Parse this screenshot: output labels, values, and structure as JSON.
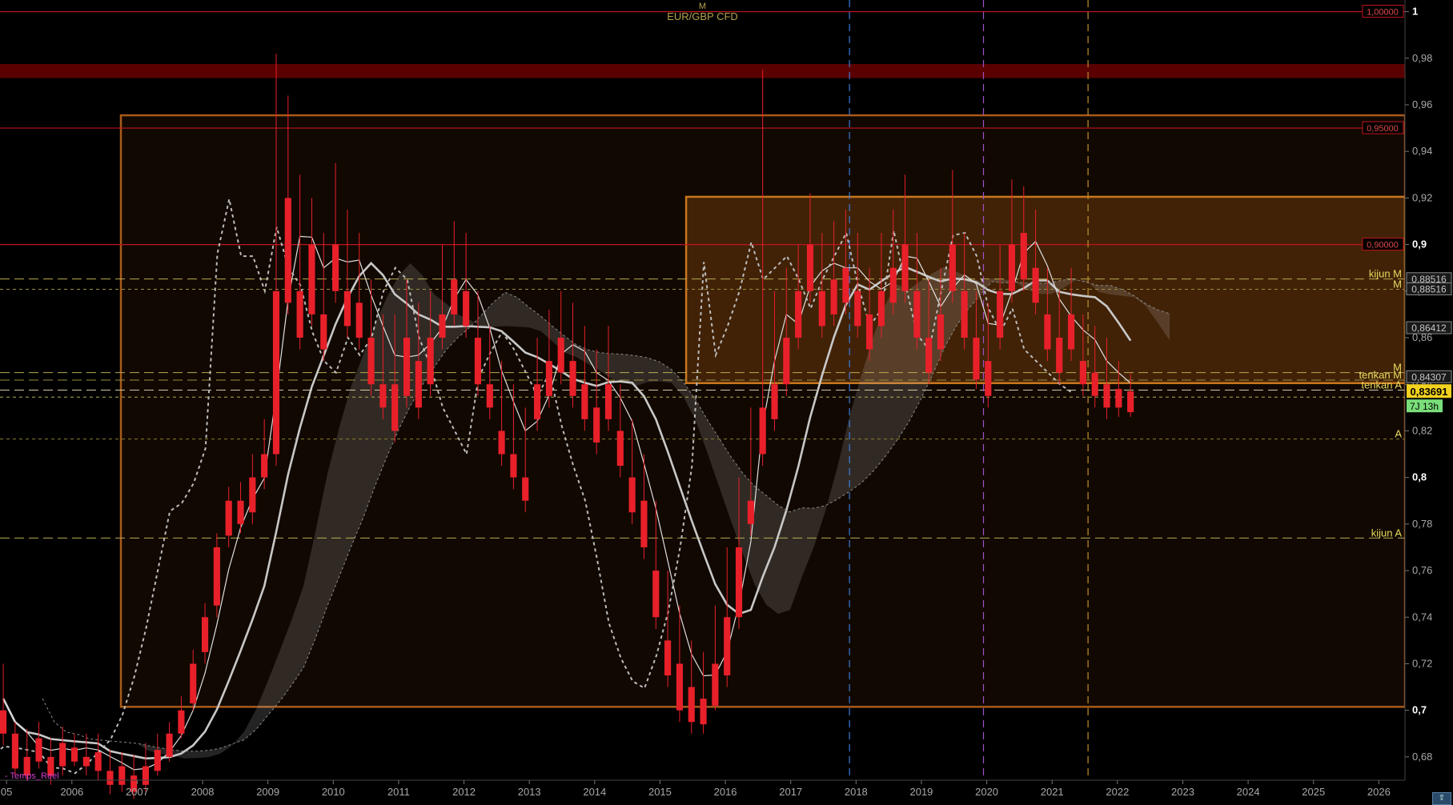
{
  "header": {
    "timeframe": "M",
    "symbol": "EUR/GBP CFD"
  },
  "status": {
    "mode": "- Temps_Reel"
  },
  "scroll_icon": "scroll-up-arrow-icon",
  "chart_data": {
    "type": "candlestick",
    "symbol": "EUR/GBP CFD",
    "timeframe": "M",
    "x_ticks": [
      "05",
      "2006",
      "2007",
      "2008",
      "2009",
      "2010",
      "2011",
      "2012",
      "2013",
      "2014",
      "2015",
      "2016",
      "2017",
      "2018",
      "2019",
      "2020",
      "2021",
      "2022",
      "2023",
      "2024",
      "2025",
      "2026"
    ],
    "y_ticks": [
      "0,68",
      "0,7",
      "0,72",
      "0,74",
      "0,76",
      "0,78",
      "0,8",
      "0,82",
      "0,84",
      "0,86",
      "0,88",
      "0,9",
      "0,92",
      "0,94",
      "0,96",
      "0,98",
      "1"
    ],
    "y_bold": [
      "0,7",
      "0,8",
      "0,9",
      "1"
    ],
    "ylim": [
      0.67,
      1.005
    ],
    "xlim": [
      2004.9,
      2026.4
    ],
    "price_levels": [
      {
        "value": 1.0,
        "label": "1,00000",
        "color": "#c0141e"
      },
      {
        "value": 0.95,
        "label": "0,95000",
        "color": "#c0141e"
      },
      {
        "value": 0.9,
        "label": "0,90000",
        "color": "#c0141e"
      }
    ],
    "resistance_zone": {
      "low": 0.9715,
      "high": 0.9775,
      "color": "#5a0000"
    },
    "boxes": [
      {
        "x0": 2006.75,
        "x1": 2026.4,
        "low": 0.7015,
        "high": 0.9555,
        "color": "#a85a18"
      },
      {
        "x0": 2015.4,
        "x1": 2026.4,
        "low": 0.8405,
        "high": 0.9205,
        "color": "#c8761e"
      }
    ],
    "dashed_levels": [
      {
        "value": 0.8852,
        "label": "kijun M",
        "color": "#b8ac52",
        "style": "long"
      },
      {
        "value": 0.8808,
        "label": "M",
        "color": "#9a9040",
        "style": "short"
      },
      {
        "value": 0.845,
        "label": "M",
        "color": "#b8ac52",
        "style": "long"
      },
      {
        "value": 0.8418,
        "label": "tenkan M",
        "color": "#9a9040",
        "style": "long"
      },
      {
        "value": 0.8375,
        "label": "tenkan A",
        "color": "#d4c8a0",
        "style": "long"
      },
      {
        "value": 0.8345,
        "label": "",
        "color": "#b8ac52",
        "style": "short"
      },
      {
        "value": 0.8165,
        "label": "A",
        "color": "#8a8030",
        "style": "short"
      },
      {
        "value": 0.774,
        "label": "kijun A",
        "color": "#b8ac52",
        "style": "long"
      }
    ],
    "vertical_lines": [
      {
        "x": 2017.9,
        "color": "#3d7ad6"
      },
      {
        "x": 2019.95,
        "color": "#a050c8"
      },
      {
        "x": 2021.55,
        "color": "#c09028"
      }
    ],
    "price_tags": [
      {
        "value": 0.88516,
        "label": "0,88516"
      },
      {
        "value": 0.8808,
        "label": "0,88516"
      },
      {
        "value": 0.86412,
        "label": "0,86412"
      },
      {
        "value": 0.84307,
        "label": "0,84307"
      }
    ],
    "last_price": {
      "value": 0.83691,
      "label": "0,83691",
      "countdown": "7J 13h"
    },
    "candles": [
      [
        0.7,
        0.72,
        0.69,
        0.685
      ],
      [
        0.69,
        0.695,
        0.675,
        0.672
      ],
      [
        0.68,
        0.692,
        0.672,
        0.67
      ],
      [
        0.688,
        0.695,
        0.678,
        0.675
      ],
      [
        0.68,
        0.688,
        0.672,
        0.668
      ],
      [
        0.686,
        0.693,
        0.676,
        0.672
      ],
      [
        0.684,
        0.69,
        0.678,
        0.676
      ],
      [
        0.68,
        0.69,
        0.676,
        0.672
      ],
      [
        0.682,
        0.69,
        0.674,
        0.67
      ],
      [
        0.674,
        0.683,
        0.668,
        0.664
      ],
      [
        0.676,
        0.682,
        0.668,
        0.665
      ],
      [
        0.672,
        0.681,
        0.665,
        0.662
      ],
      [
        0.676,
        0.686,
        0.668,
        0.665
      ],
      [
        0.683,
        0.69,
        0.674,
        0.672
      ],
      [
        0.69,
        0.695,
        0.68,
        0.678
      ],
      [
        0.7,
        0.706,
        0.69,
        0.688
      ],
      [
        0.72,
        0.726,
        0.703,
        0.7
      ],
      [
        0.74,
        0.746,
        0.725,
        0.72
      ],
      [
        0.77,
        0.776,
        0.745,
        0.74
      ],
      [
        0.79,
        0.796,
        0.775,
        0.77
      ],
      [
        0.79,
        0.798,
        0.78,
        0.776
      ],
      [
        0.8,
        0.81,
        0.785,
        0.78
      ],
      [
        0.81,
        0.825,
        0.8,
        0.795
      ],
      [
        0.88,
        0.982,
        0.81,
        0.805
      ],
      [
        0.92,
        0.964,
        0.875,
        0.87
      ],
      [
        0.88,
        0.93,
        0.86,
        0.855
      ],
      [
        0.9,
        0.92,
        0.87,
        0.865
      ],
      [
        0.87,
        0.905,
        0.855,
        0.85
      ],
      [
        0.9,
        0.935,
        0.88,
        0.875
      ],
      [
        0.88,
        0.915,
        0.865,
        0.86
      ],
      [
        0.875,
        0.905,
        0.86,
        0.855
      ],
      [
        0.86,
        0.885,
        0.84,
        0.835
      ],
      [
        0.84,
        0.87,
        0.83,
        0.825
      ],
      [
        0.84,
        0.87,
        0.82,
        0.815
      ],
      [
        0.86,
        0.885,
        0.835,
        0.83
      ],
      [
        0.85,
        0.875,
        0.83,
        0.825
      ],
      [
        0.86,
        0.88,
        0.84,
        0.835
      ],
      [
        0.87,
        0.9,
        0.86,
        0.855
      ],
      [
        0.885,
        0.91,
        0.87,
        0.865
      ],
      [
        0.88,
        0.905,
        0.865,
        0.86
      ],
      [
        0.86,
        0.88,
        0.84,
        0.835
      ],
      [
        0.84,
        0.865,
        0.83,
        0.825
      ],
      [
        0.82,
        0.85,
        0.81,
        0.805
      ],
      [
        0.81,
        0.84,
        0.8,
        0.795
      ],
      [
        0.8,
        0.83,
        0.79,
        0.785
      ],
      [
        0.84,
        0.86,
        0.825,
        0.82
      ],
      [
        0.85,
        0.872,
        0.835,
        0.83
      ],
      [
        0.86,
        0.88,
        0.845,
        0.84
      ],
      [
        0.85,
        0.875,
        0.835,
        0.83
      ],
      [
        0.84,
        0.865,
        0.825,
        0.82
      ],
      [
        0.83,
        0.855,
        0.815,
        0.81
      ],
      [
        0.84,
        0.865,
        0.825,
        0.82
      ],
      [
        0.82,
        0.84,
        0.805,
        0.8
      ],
      [
        0.8,
        0.825,
        0.785,
        0.78
      ],
      [
        0.79,
        0.81,
        0.77,
        0.765
      ],
      [
        0.76,
        0.79,
        0.74,
        0.735
      ],
      [
        0.73,
        0.76,
        0.715,
        0.71
      ],
      [
        0.72,
        0.745,
        0.7,
        0.695
      ],
      [
        0.71,
        0.73,
        0.695,
        0.69
      ],
      [
        0.705,
        0.725,
        0.694,
        0.69
      ],
      [
        0.72,
        0.745,
        0.702,
        0.7
      ],
      [
        0.74,
        0.77,
        0.715,
        0.71
      ],
      [
        0.77,
        0.8,
        0.74,
        0.735
      ],
      [
        0.79,
        0.83,
        0.78,
        0.775
      ],
      [
        0.83,
        0.975,
        0.81,
        0.805
      ],
      [
        0.84,
        0.88,
        0.825,
        0.82
      ],
      [
        0.86,
        0.89,
        0.84,
        0.835
      ],
      [
        0.88,
        0.9,
        0.86,
        0.855
      ],
      [
        0.9,
        0.922,
        0.88,
        0.875
      ],
      [
        0.88,
        0.905,
        0.865,
        0.86
      ],
      [
        0.885,
        0.91,
        0.87,
        0.865
      ],
      [
        0.89,
        0.915,
        0.875,
        0.87
      ],
      [
        0.88,
        0.905,
        0.865,
        0.86
      ],
      [
        0.87,
        0.89,
        0.855,
        0.85
      ],
      [
        0.88,
        0.905,
        0.865,
        0.86
      ],
      [
        0.89,
        0.915,
        0.875,
        0.87
      ],
      [
        0.9,
        0.93,
        0.88,
        0.875
      ],
      [
        0.88,
        0.905,
        0.86,
        0.855
      ],
      [
        0.86,
        0.885,
        0.845,
        0.84
      ],
      [
        0.87,
        0.89,
        0.855,
        0.85
      ],
      [
        0.9,
        0.932,
        0.88,
        0.875
      ],
      [
        0.88,
        0.905,
        0.86,
        0.855
      ],
      [
        0.86,
        0.88,
        0.842,
        0.838
      ],
      [
        0.85,
        0.875,
        0.835,
        0.83
      ],
      [
        0.88,
        0.9,
        0.86,
        0.855
      ],
      [
        0.9,
        0.928,
        0.88,
        0.875
      ],
      [
        0.905,
        0.925,
        0.885,
        0.88
      ],
      [
        0.89,
        0.915,
        0.875,
        0.87
      ],
      [
        0.87,
        0.89,
        0.855,
        0.85
      ],
      [
        0.86,
        0.88,
        0.845,
        0.84
      ],
      [
        0.87,
        0.89,
        0.855,
        0.85
      ],
      [
        0.85,
        0.87,
        0.84,
        0.835
      ],
      [
        0.845,
        0.865,
        0.835,
        0.83
      ],
      [
        0.84,
        0.86,
        0.83,
        0.825
      ],
      [
        0.838,
        0.85,
        0.83,
        0.826
      ],
      [
        0.837,
        0.845,
        0.828,
        0.826
      ]
    ]
  }
}
